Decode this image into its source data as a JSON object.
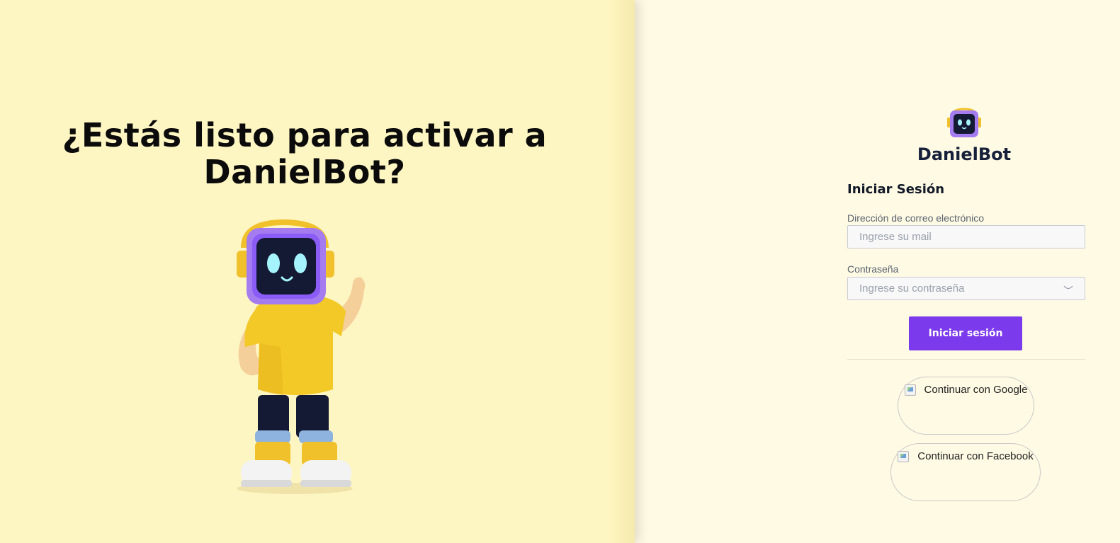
{
  "hero": {
    "title": "¿Estás listo para activar a DanielBot?"
  },
  "brand": {
    "name": "DanielBot"
  },
  "login": {
    "title": "Iniciar Sesión",
    "email_label": "Dirección de correo electrónico",
    "email_placeholder": "Ingrese su mail",
    "email_value": "",
    "password_label": "Contraseña",
    "password_placeholder": "Ingrese su contraseña",
    "password_value": "",
    "submit_label": "Iniciar sesión"
  },
  "social": {
    "google_label": "Continuar con Google",
    "facebook_label": "Continuar con Facebook"
  },
  "colors": {
    "left_bg": "#fef6c2",
    "right_bg": "#fefae4",
    "accent": "#7c3aed",
    "brand_text": "#17203a"
  },
  "icons": {
    "password_toggle": "eye-closed-icon",
    "mascot": "robot-mascot-illustration",
    "logo": "robot-head-logo-icon"
  }
}
